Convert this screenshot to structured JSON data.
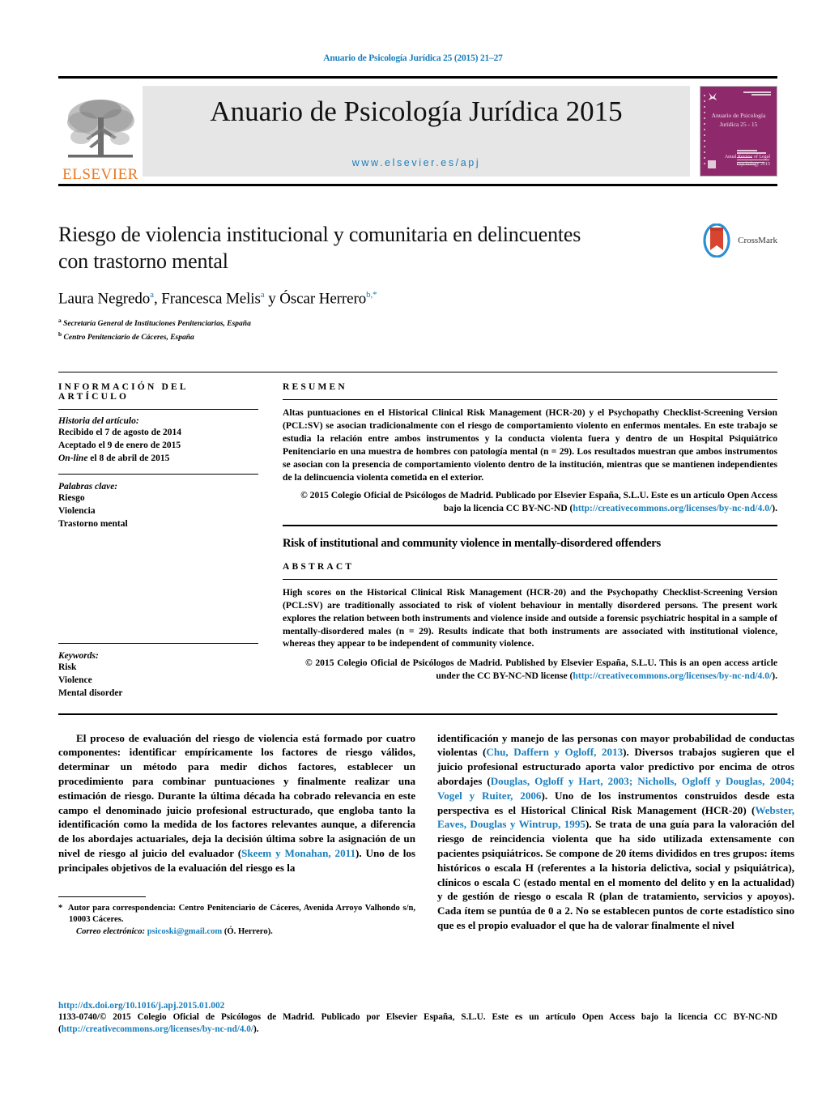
{
  "running_head": "Anuario de Psicología Jurídica 25 (2015) 21–27",
  "masthead": {
    "publisher_word": "ELSEVIER",
    "journal_title": "Anuario de Psicología Jurídica 2015",
    "journal_url": "www.elsevier.es/apj",
    "cover": {
      "title_line1": "Anuario de Psicología",
      "title_line2": "Jurídica 25 - 15",
      "footer_line1": "Anual Review of Legal",
      "footer_line2": "Psychology 2015"
    }
  },
  "article": {
    "title": "Riesgo de violencia institucional y comunitaria en delincuentes con trastorno mental",
    "title_line1": "Riesgo de violencia institucional y comunitaria en delincuentes",
    "title_line2": "con trastorno mental",
    "authors_plain": "Laura Negredo a, Francesca Melis a y Óscar Herrero b,*",
    "author1": "Laura Negredo",
    "author1_sup": "a",
    "author1_sep": ",  ",
    "author2": "Francesca Melis",
    "author2_sup": "a",
    "author_conj": " y ",
    "author3": "Óscar Herrero",
    "author3_sup": "b,*",
    "affiliation_a_marker": "a",
    "affiliation_a": "Secretaría General de Instituciones Penitenciarias, España",
    "affiliation_b_marker": "b",
    "affiliation_b": "Centro Penitenciario de Cáceres, España",
    "crossmark_label": "CrossMark"
  },
  "info_panel": {
    "heading": "INFORMACIÓN DEL ARTÍCULO",
    "history_label": "Historia del artículo:",
    "history_received": "Recibido el 7 de agosto de 2014",
    "history_accepted": "Aceptado el 9 de enero de 2015",
    "history_online_italic": "On-line",
    "history_online_rest": " el 8 de abril de 2015",
    "keywords_es_label": "Palabras clave:",
    "keywords_es": [
      "Riesgo",
      "Violencia",
      "Trastorno mental"
    ],
    "keywords_en_label": "Keywords:",
    "keywords_en": [
      "Risk",
      "Violence",
      "Mental disorder"
    ]
  },
  "resumen": {
    "heading": "RESUMEN",
    "text": "Altas puntuaciones en el Historical Clinical Risk Management (HCR-20) y el Psychopathy Checklist-Screening Version (PCL:SV) se asocian tradicionalmente con el riesgo de comportamiento violento en enfermos mentales. En este trabajo se estudia la relación entre ambos instrumentos y la conducta violenta fuera y dentro de un Hospital Psiquiátrico Penitenciario en una muestra de hombres con patología mental (n = 29). Los resultados muestran que ambos instrumentos se asocian con la presencia de comportamiento violento dentro de la institución, mientras que se mantienen independientes de la delincuencia violenta cometida en el exterior.",
    "copyright_part1": "© 2015 Colegio Oficial de Psicólogos de Madrid. Publicado por Elsevier España, S.L.U. Este es un artículo Open Access bajo la licencia CC BY-NC-ND (",
    "copyright_link": "http://creativecommons.org/licenses/by-nc-nd/4.0/",
    "copyright_part2": ")."
  },
  "abstract": {
    "title": "Risk of institutional and community violence in mentally-disordered offenders",
    "heading": "ABSTRACT",
    "text": "High scores on the Historical Clinical Risk Management (HCR-20) and the Psychopathy Checklist-Screening Version (PCL:SV) are traditionally associated to risk of violent behaviour in mentally disordered persons. The present work explores the relation between both instruments and violence inside and outside a forensic psychiatric hospital in a sample of mentally-disordered males (n = 29). Results indicate that both instruments are associated with institutional violence, whereas they appear to be independent of community violence.",
    "copyright_part1": "© 2015 Colegio Oficial de Psicólogos de Madrid. Published by Elsevier España, S.L.U. This is an open access article under the CC BY-NC-ND license (",
    "copyright_link": "http://creativecommons.org/licenses/by-nc-nd/4.0/",
    "copyright_part2": ")."
  },
  "body": {
    "left_paragraph_1": "El proceso de evaluación del riesgo de violencia está formado por cuatro componentes: identificar empíricamente los factores de riesgo válidos, determinar un método para medir dichos factores, establecer un procedimiento para combinar puntuaciones y finalmente realizar una estimación de riesgo. Durante la última década ha cobrado relevancia en este campo el denominado juicio profesional estructurado, que engloba tanto la identificación como la medida de los factores relevantes aunque, a diferencia de los abordajes actuariales, deja la decisión última sobre la asignación de un nivel de riesgo al juicio del evaluador (",
    "left_cite_1": "Skeem y Monahan, 2011",
    "left_paragraph_1b": "). Uno de los principales objetivos de la evaluación del riesgo es la",
    "right_segment_1": "identificación y manejo de las personas con mayor probabilidad de conductas violentas (",
    "right_cite_1": "Chu, Daffern y Ogloff, 2013",
    "right_segment_2": "). Diversos trabajos sugieren que el juicio profesional estructurado aporta valor predictivo por encima de otros abordajes (",
    "right_cite_2": "Douglas, Ogloff y Hart, 2003; Nicholls, Ogloff y Douglas, 2004; Vogel y Ruiter, 2006",
    "right_segment_3": "). Uno de los instrumentos construidos desde esta perspectiva es el Historical Clinical Risk Management (HCR-20) (",
    "right_cite_3": "Webster, Eaves, Douglas y Wintrup, 1995",
    "right_segment_4": "). Se trata de una guía para la valoración del riesgo de reincidencia violenta que ha sido utilizada extensamente con pacientes psiquiátricos. Se compone de 20 ítems divididos en tres grupos: ítems históricos o escala H (referentes a la historia delictiva, social y psiquiátrica), clínicos o escala C (estado mental en el momento del delito y en la actualidad) y de gestión de riesgo o escala R (plan de tratamiento, servicios y apoyos). Cada ítem se puntúa de 0 a 2. No se establecen puntos de corte estadístico sino que es el propio evaluador el que ha de valorar finalmente el nivel"
  },
  "correspondence": {
    "marker": "*",
    "text": "Autor para correspondencia: Centro Penitenciario de Cáceres, Avenida Arroyo Valhondo s/n, 10003 Cáceres.",
    "email_label": "Correo electrónico:",
    "email": "psicoski@gmail.com",
    "email_owner": "(Ó. Herrero)."
  },
  "footer": {
    "doi": "http://dx.doi.org/10.1016/j.apj.2015.01.002",
    "issn_copyright_part1": "1133-0740/© 2015 Colegio Oficial de Psicólogos de Madrid. Publicado por Elsevier España, S.L.U. Este es un artículo Open Access bajo la licencia CC BY-NC-ND (",
    "issn_copyright_link": "http://creativecommons.org/licenses/by-nc-nd/4.0/",
    "issn_copyright_part2": ")."
  },
  "colors": {
    "link_blue": "#1a7fbd",
    "elsevier_orange": "#E87722",
    "cover_purple": "#8e2a6b",
    "band_gray": "#e6e6e6"
  }
}
